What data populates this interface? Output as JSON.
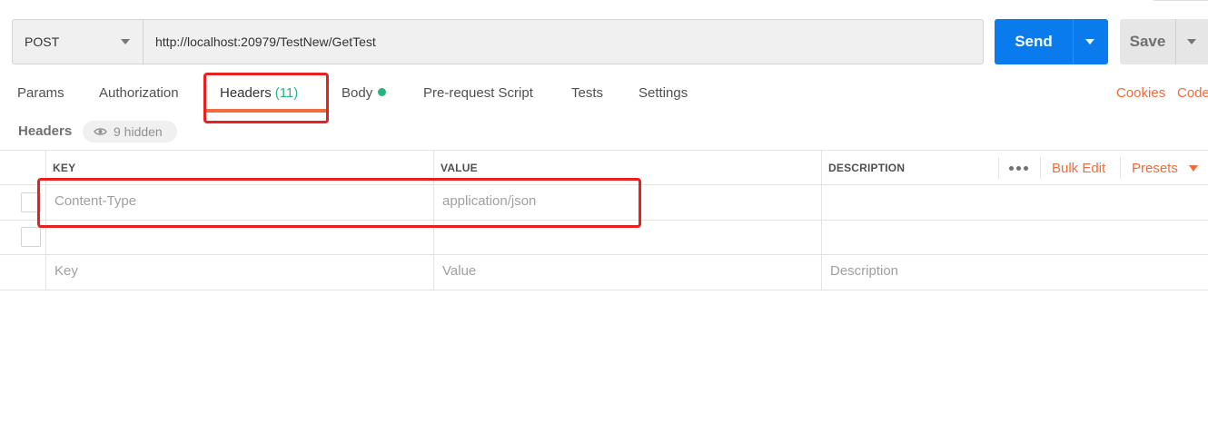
{
  "request": {
    "method": "POST",
    "url": "http://localhost:20979/TestNew/GetTest",
    "send_label": "Send",
    "save_label": "Save"
  },
  "tabs": [
    {
      "label": "Params"
    },
    {
      "label": "Authorization"
    },
    {
      "label": "Headers",
      "count": "(11)",
      "active": true
    },
    {
      "label": "Body",
      "status_dot": true
    },
    {
      "label": "Pre-request Script"
    },
    {
      "label": "Tests"
    },
    {
      "label": "Settings"
    }
  ],
  "right_links": {
    "cookies": "Cookies",
    "code": "Code"
  },
  "headers_section": {
    "title": "Headers",
    "hidden_label": "9 hidden"
  },
  "table": {
    "columns": {
      "key": "KEY",
      "value": "VALUE",
      "description": "DESCRIPTION"
    },
    "bulk_edit": "Bulk Edit",
    "presets": "Presets",
    "rows": [
      {
        "key": "Content-Type",
        "value": "application/json",
        "description": ""
      },
      {
        "key": "",
        "value": "",
        "description": ""
      }
    ],
    "placeholders": {
      "key": "Key",
      "value": "Value",
      "description": "Description"
    }
  },
  "colors": {
    "send": "#097bed",
    "accent_orange": "#f26b3a",
    "count_green": "#26b47f",
    "annotation_red": "#e8201e"
  },
  "icons": {
    "eye": "eye-icon",
    "more": "more-horizontal-icon",
    "caret": "caret-down-icon"
  }
}
